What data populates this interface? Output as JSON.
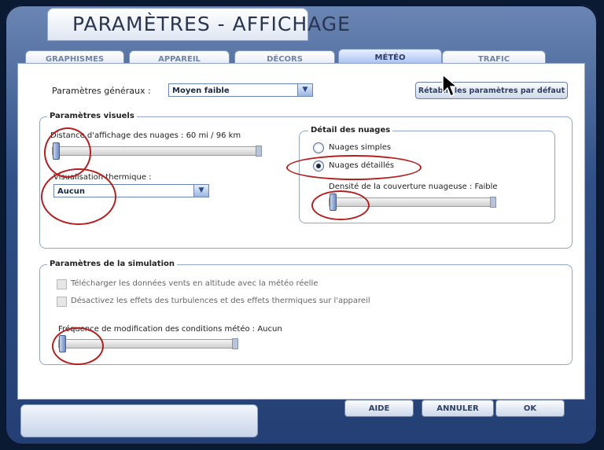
{
  "window": {
    "title": "PARAMÈTRES - AFFICHAGE"
  },
  "tabs": [
    {
      "label": "GRAPHISMES",
      "active": false
    },
    {
      "label": "APPAREIL",
      "active": false
    },
    {
      "label": "DÉCORS",
      "active": false
    },
    {
      "label": "MÉTÉO",
      "active": true
    },
    {
      "label": "TRAFIC",
      "active": false
    }
  ],
  "general": {
    "label": "Paramètres généraux :",
    "value": "Moyen faible",
    "reset_button": "Rétablir les paramètres par défaut"
  },
  "visual": {
    "group_title": "Paramètres visuels",
    "cloud_distance_label": "Distance d'affichage des nuages : 60 mi / 96 km",
    "cloud_distance_level": 0,
    "thermal_label": "Visualisation thermique :",
    "thermal_value": "Aucun",
    "cloud_detail": {
      "group_title": "Détail des nuages",
      "option_simple": "Nuages simples",
      "option_detailed": "Nuages détaillés",
      "selected": "Nuages détaillés",
      "density_label": "Densité de la couverture nuageuse : Faible",
      "density_level": 0
    }
  },
  "simulation": {
    "group_title": "Paramètres de la simulation",
    "checkbox_winds": "Télécharger les données vents en altitude avec la météo réelle",
    "checkbox_turbulence": "Désactivez les effets des turbulences et des effets thermiques sur l'appareil",
    "frequency_label": "Fréquence de modification des conditions météo : Aucun",
    "frequency_level": 0
  },
  "footer": {
    "help": "AIDE",
    "cancel": "ANNULER",
    "ok": "OK"
  },
  "colors": {
    "annotation_circle": "#b32020",
    "active_tab": "#8fb0ee",
    "frame": "#2f4f86"
  }
}
